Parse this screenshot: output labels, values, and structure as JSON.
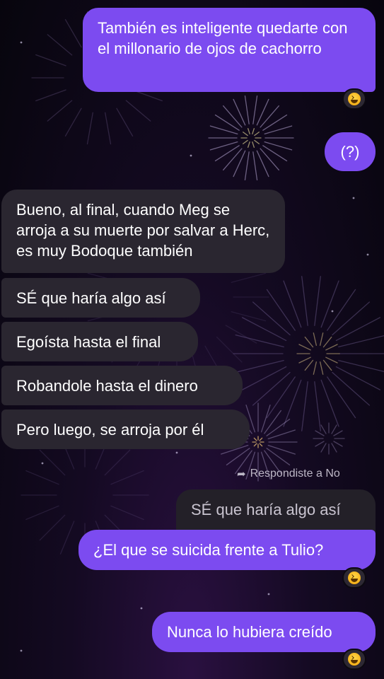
{
  "colors": {
    "outgoing": "#7c4bf0",
    "incoming": "#2a2630",
    "background": "#0b0712"
  },
  "messages": [
    {
      "id": "m1",
      "direction": "out",
      "text": "También es inteligente quedarte con el millonario de ojos de cachorro",
      "reaction": "grinning-squint-emoji"
    },
    {
      "id": "m2",
      "direction": "out",
      "text": "(?)"
    },
    {
      "id": "m3",
      "direction": "in",
      "text": "Bueno, al final, cuando Meg se arroja a su muerte por salvar a Herc, es muy Bodoque también"
    },
    {
      "id": "m4",
      "direction": "in",
      "text": "SÉ que haría algo así"
    },
    {
      "id": "m5",
      "direction": "in",
      "text": "Egoísta hasta el final"
    },
    {
      "id": "m6",
      "direction": "in",
      "text": "Robandole hasta el dinero"
    },
    {
      "id": "m7",
      "direction": "in",
      "text": "Pero luego, se arroja por él"
    },
    {
      "id": "m8",
      "direction": "out",
      "reply_label": "Respondiste a No",
      "quoted_text": "SÉ que haría algo así",
      "text": "¿El que se suicida frente a Tulio?",
      "reaction": "grinning-squint-emoji"
    },
    {
      "id": "m9",
      "direction": "out",
      "text": "Nunca lo hubiera creído",
      "reaction": "grinning-squint-emoji"
    }
  ]
}
